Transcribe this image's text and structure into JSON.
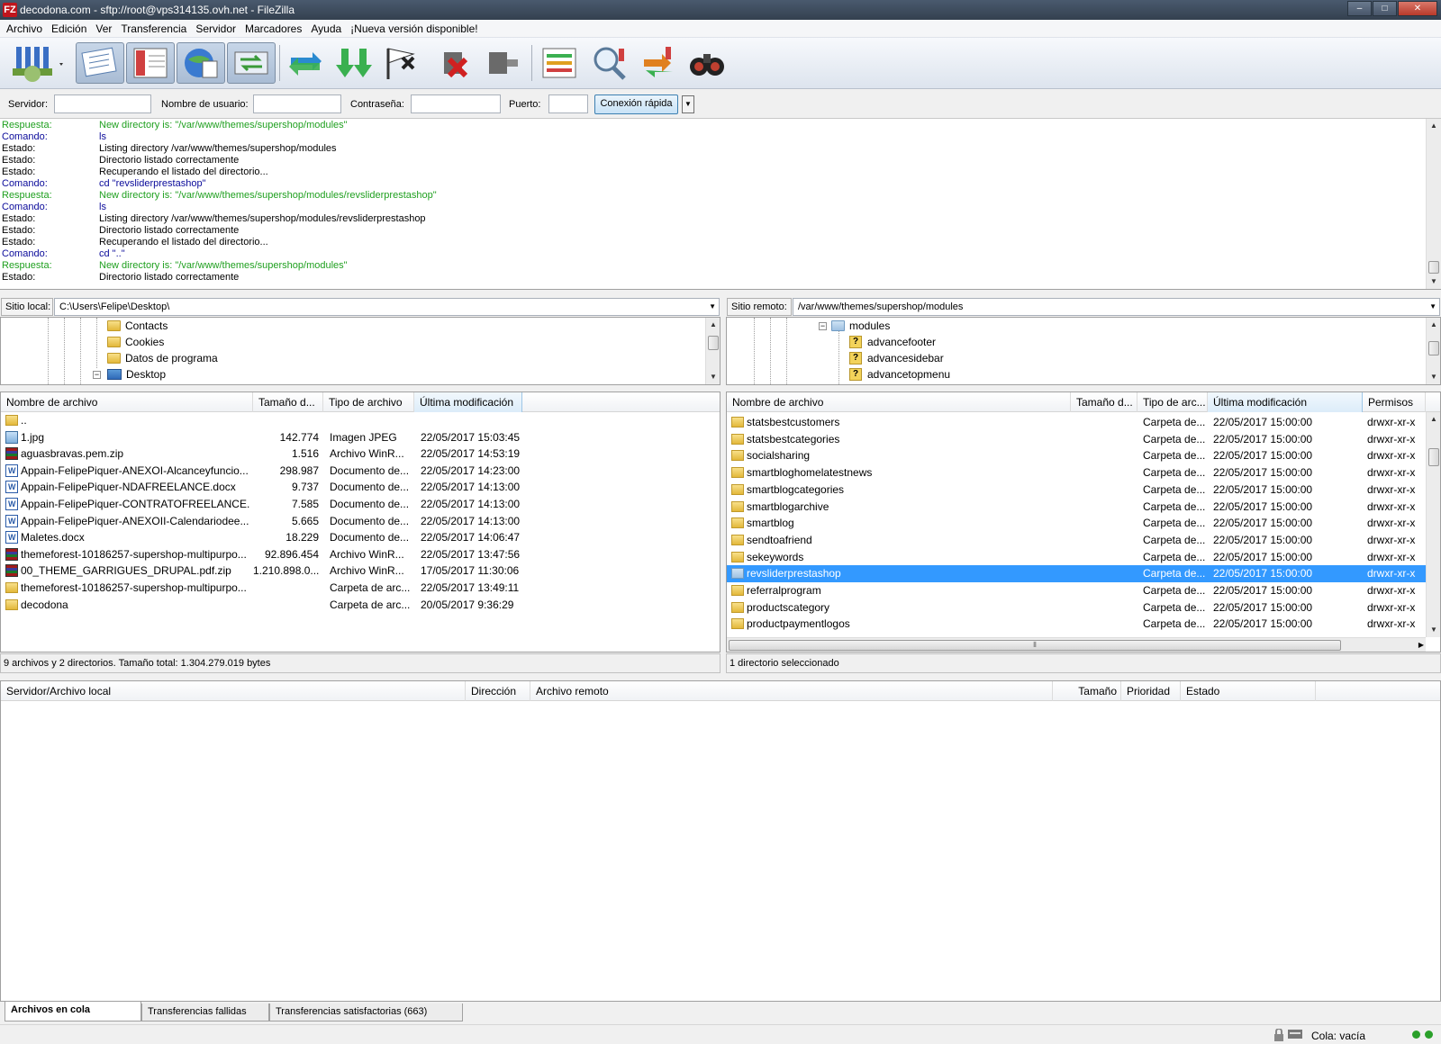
{
  "window": {
    "title": "decodona.com - sftp://root@vps314135.ovh.net - FileZilla",
    "app_icon": "FZ",
    "minimize": "–",
    "maximize": "□",
    "close": "✕"
  },
  "menu": [
    "Archivo",
    "Edición",
    "Ver",
    "Transferencia",
    "Servidor",
    "Marcadores",
    "Ayuda",
    "¡Nueva versión disponible!"
  ],
  "toolbar": {
    "icons": [
      "site-manager-icon",
      "toggle-log-icon",
      "toggle-local-tree-icon",
      "toggle-remote-tree-icon",
      "toggle-queue-icon",
      "refresh-icon",
      "process-queue-icon",
      "cancel-operation-icon",
      "disconnect-icon",
      "reconnect-icon",
      "directory-filter-icon",
      "directory-compare-icon",
      "sync-browse-icon",
      "search-icon"
    ]
  },
  "quickconnect": {
    "host_label": "Servidor:",
    "host_value": "",
    "user_label": "Nombre de usuario:",
    "user_value": "",
    "pass_label": "Contraseña:",
    "pass_value": "",
    "port_label": "Puerto:",
    "port_value": "",
    "button": "Conexión rápida",
    "dropdown_arrow": "▼"
  },
  "log": [
    {
      "kind": "Respuesta:",
      "msg": "New directory is: \"/var/www/themes/supershop/modules\"",
      "type": "resp"
    },
    {
      "kind": "Comando:",
      "msg": "ls",
      "type": "cmd"
    },
    {
      "kind": "Estado:",
      "msg": "Listing directory /var/www/themes/supershop/modules",
      "type": "st"
    },
    {
      "kind": "Estado:",
      "msg": "Directorio listado correctamente",
      "type": "st"
    },
    {
      "kind": "Estado:",
      "msg": "Recuperando el listado del directorio...",
      "type": "st"
    },
    {
      "kind": "Comando:",
      "msg": "cd \"revsliderprestashop\"",
      "type": "cmd"
    },
    {
      "kind": "Respuesta:",
      "msg": "New directory is: \"/var/www/themes/supershop/modules/revsliderprestashop\"",
      "type": "resp"
    },
    {
      "kind": "Comando:",
      "msg": "ls",
      "type": "cmd"
    },
    {
      "kind": "Estado:",
      "msg": "Listing directory /var/www/themes/supershop/modules/revsliderprestashop",
      "type": "st"
    },
    {
      "kind": "Estado:",
      "msg": "Directorio listado correctamente",
      "type": "st"
    },
    {
      "kind": "Estado:",
      "msg": "Recuperando el listado del directorio...",
      "type": "st"
    },
    {
      "kind": "Comando:",
      "msg": "cd \"..\"",
      "type": "cmd"
    },
    {
      "kind": "Respuesta:",
      "msg": "New directory is: \"/var/www/themes/supershop/modules\"",
      "type": "resp"
    },
    {
      "kind": "Estado:",
      "msg": "Directorio listado correctamente",
      "type": "st"
    }
  ],
  "local": {
    "path_label": "Sitio local:",
    "path": "C:\\Users\\Felipe\\Desktop\\",
    "tree": [
      "Contacts",
      "Cookies",
      "Datos de programa",
      "Desktop"
    ],
    "headers": [
      "Nombre de archivo",
      "Tamaño d...",
      "Tipo de archivo",
      "Última modificación"
    ],
    "files": [
      {
        "name": "..",
        "size": "",
        "type": "",
        "date": "",
        "icon": "folder2"
      },
      {
        "name": "1.jpg",
        "size": "142.774",
        "type": "Imagen JPEG",
        "date": "22/05/2017 15:03:45",
        "icon": "img"
      },
      {
        "name": "aguasbravas.pem.zip",
        "size": "1.516",
        "type": "Archivo WinR...",
        "date": "22/05/2017 14:53:19",
        "icon": "zip"
      },
      {
        "name": "Appain-FelipePiquer-ANEXOI-Alcanceyfuncio...",
        "size": "298.987",
        "type": "Documento de...",
        "date": "22/05/2017 14:23:00",
        "icon": "doc"
      },
      {
        "name": "Appain-FelipePiquer-NDAFREELANCE.docx",
        "size": "9.737",
        "type": "Documento de...",
        "date": "22/05/2017 14:13:00",
        "icon": "doc"
      },
      {
        "name": "Appain-FelipePiquer-CONTRATOFREELANCE....",
        "size": "7.585",
        "type": "Documento de...",
        "date": "22/05/2017 14:13:00",
        "icon": "doc"
      },
      {
        "name": "Appain-FelipePiquer-ANEXOII-Calendariodee...",
        "size": "5.665",
        "type": "Documento de...",
        "date": "22/05/2017 14:13:00",
        "icon": "doc"
      },
      {
        "name": "Maletes.docx",
        "size": "18.229",
        "type": "Documento de...",
        "date": "22/05/2017 14:06:47",
        "icon": "doc"
      },
      {
        "name": "themeforest-10186257-supershop-multipurpo...",
        "size": "92.896.454",
        "type": "Archivo WinR...",
        "date": "22/05/2017 13:47:56",
        "icon": "zip"
      },
      {
        "name": "00_THEME_GARRIGUES_DRUPAL.pdf.zip",
        "size": "1.210.898.0...",
        "type": "Archivo WinR...",
        "date": "17/05/2017 11:30:06",
        "icon": "zip"
      },
      {
        "name": "themeforest-10186257-supershop-multipurpo...",
        "size": "",
        "type": "Carpeta de arc...",
        "date": "22/05/2017 13:49:11",
        "icon": "folder2"
      },
      {
        "name": "decodona",
        "size": "",
        "type": "Carpeta de arc...",
        "date": "20/05/2017 9:36:29",
        "icon": "folder2"
      }
    ],
    "status": "9 archivos y 2 directorios. Tamaño total: 1.304.279.019 bytes"
  },
  "remote": {
    "path_label": "Sitio remoto:",
    "path": "/var/www/themes/supershop/modules",
    "tree": [
      "modules",
      "advancefooter",
      "advancesidebar",
      "advancetopmenu"
    ],
    "headers": [
      "Nombre de archivo",
      "Tamaño d...",
      "Tipo de arc...",
      "Última modificación",
      "Permisos"
    ],
    "files": [
      {
        "name": "statsbestcustomers",
        "type": "Carpeta de...",
        "date": "22/05/2017 15:00:00",
        "perm": "drwxr-xr-x"
      },
      {
        "name": "statsbestcategories",
        "type": "Carpeta de...",
        "date": "22/05/2017 15:00:00",
        "perm": "drwxr-xr-x"
      },
      {
        "name": "socialsharing",
        "type": "Carpeta de...",
        "date": "22/05/2017 15:00:00",
        "perm": "drwxr-xr-x"
      },
      {
        "name": "smartbloghomelatestnews",
        "type": "Carpeta de...",
        "date": "22/05/2017 15:00:00",
        "perm": "drwxr-xr-x"
      },
      {
        "name": "smartblogcategories",
        "type": "Carpeta de...",
        "date": "22/05/2017 15:00:00",
        "perm": "drwxr-xr-x"
      },
      {
        "name": "smartblogarchive",
        "type": "Carpeta de...",
        "date": "22/05/2017 15:00:00",
        "perm": "drwxr-xr-x"
      },
      {
        "name": "smartblog",
        "type": "Carpeta de...",
        "date": "22/05/2017 15:00:00",
        "perm": "drwxr-xr-x"
      },
      {
        "name": "sendtoafriend",
        "type": "Carpeta de...",
        "date": "22/05/2017 15:00:00",
        "perm": "drwxr-xr-x"
      },
      {
        "name": "sekeywords",
        "type": "Carpeta de...",
        "date": "22/05/2017 15:00:00",
        "perm": "drwxr-xr-x"
      },
      {
        "name": "revsliderprestashop",
        "type": "Carpeta de...",
        "date": "22/05/2017 15:00:00",
        "perm": "drwxr-xr-x",
        "selected": true
      },
      {
        "name": "referralprogram",
        "type": "Carpeta de...",
        "date": "22/05/2017 15:00:00",
        "perm": "drwxr-xr-x"
      },
      {
        "name": "productscategory",
        "type": "Carpeta de...",
        "date": "22/05/2017 15:00:00",
        "perm": "drwxr-xr-x"
      },
      {
        "name": "productpaymentlogos",
        "type": "Carpeta de...",
        "date": "22/05/2017 15:00:00",
        "perm": "drwxr-xr-x"
      }
    ],
    "status": "1 directorio seleccionado"
  },
  "queue": {
    "headers": [
      "Servidor/Archivo local",
      "Dirección",
      "Archivo remoto",
      "Tamaño",
      "Prioridad",
      "Estado"
    ]
  },
  "tabs": [
    "Archivos en cola",
    "Transferencias fallidas",
    "Transferencias satisfactorias (663)"
  ],
  "statusbar": {
    "queue": "Cola: vacía"
  },
  "colors": {
    "response": "#20a020",
    "command": "#0a0a9a",
    "selection": "#3399ff"
  }
}
